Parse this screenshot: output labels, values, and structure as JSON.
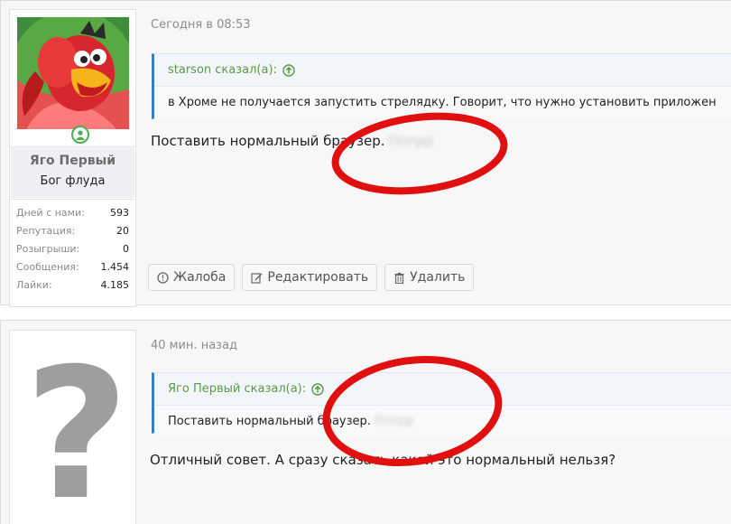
{
  "posts": [
    {
      "time": "Сегодня в 08:53",
      "user": {
        "name": "Яго Первый",
        "title": "Бог флуда",
        "stats": [
          {
            "label": "Дней с нами:",
            "value": "593"
          },
          {
            "label": "Репутация:",
            "value": "20"
          },
          {
            "label": "Розыгрыши:",
            "value": "0"
          },
          {
            "label": "Сообщения:",
            "value": "1.454"
          },
          {
            "label": "Лайки:",
            "value": "4.185"
          }
        ]
      },
      "quote": {
        "author": "starson сказал(а):",
        "text": "в Хроме не получается запустить стрелядку. Говорит, что нужно установить приложен"
      },
      "message": "Поставить нормальный браузер.",
      "blurred": "Пппрр",
      "actions": {
        "report": "Жалоба",
        "edit": "Редактировать",
        "delete": "Удалить"
      }
    },
    {
      "time": "40 мин. назад",
      "quote": {
        "author": "Яго Первый сказал(а):",
        "text": "Поставить нормальный браузер.",
        "blurred": "Пппрр"
      },
      "message": "Отличный совет. А сразу сказать какой это нормальный нельзя?"
    }
  ],
  "icons": {
    "online": "user-online-icon",
    "quote_up": "arrow-up-circle-icon",
    "report": "exclamation-circle-icon",
    "edit": "pencil-icon",
    "delete": "trash-icon"
  },
  "colors": {
    "quote_border": "#3f7cbf",
    "quote_author": "#5b9a46",
    "annotation": "#e01010"
  }
}
